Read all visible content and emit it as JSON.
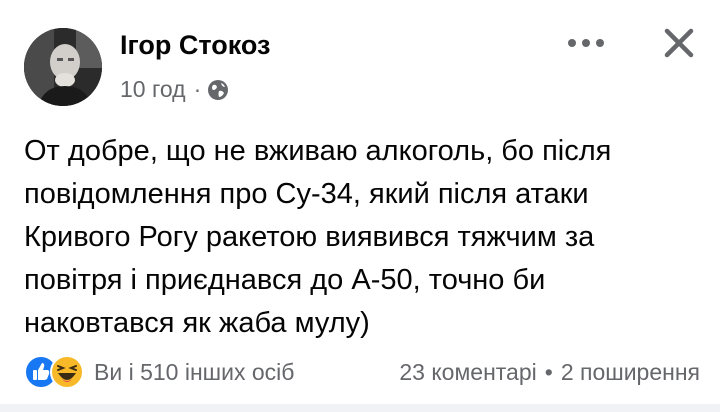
{
  "post": {
    "author": "Ігор Стокоз",
    "time": "10 год",
    "separator": "·",
    "privacy_icon": "globe-icon",
    "text_lines": [
      "От добре, що не вживаю алкоголь, бо після",
      "повідомлення про Су-34, який після атаки",
      "Кривого Рогу ракетою виявився тяжчим за",
      "повітря і приєднався до А-50, точно би",
      "наковтався як жаба мулу)"
    ]
  },
  "footer": {
    "reactions": [
      "like-icon",
      "haha-icon"
    ],
    "reactions_text": "Ви і 510 інших осіб",
    "comments": "23 коментарі",
    "dot": "•",
    "shares": "2 поширення"
  },
  "colors": {
    "text": "#050505",
    "secondary": "#65676b",
    "like_blue": "#1877f2",
    "haha_yellow": "#f7b928"
  }
}
